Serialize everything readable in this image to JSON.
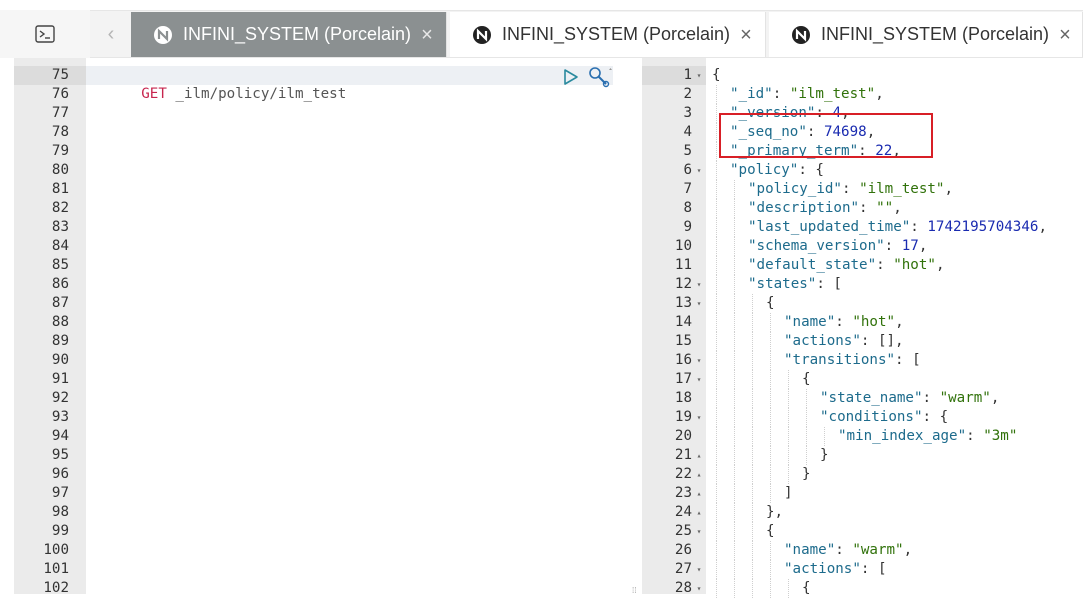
{
  "tabbar": {
    "console_icon": "terminal-icon",
    "prev_icon": "chevron-left-icon",
    "tabs": [
      {
        "label": "INFINI_SYSTEM (Porcelain)",
        "active": true,
        "icon": "cluster-logo-icon",
        "close": "×"
      },
      {
        "label": "INFINI_SYSTEM (Porcelain)",
        "active": false,
        "icon": "cluster-logo-icon",
        "close": "×"
      },
      {
        "label": "INFINI_SYSTEM (Porcelain)",
        "active": false,
        "icon": "cluster-logo-icon",
        "close": "×"
      }
    ]
  },
  "request_editor": {
    "line_numbers": [
      "75",
      "76",
      "77",
      "78",
      "79",
      "80",
      "81",
      "82",
      "83",
      "84",
      "85",
      "86",
      "87",
      "88",
      "89",
      "90",
      "91",
      "92",
      "93",
      "94",
      "95",
      "96",
      "97",
      "98",
      "99",
      "100",
      "101",
      "102"
    ],
    "method": "GET",
    "url": "_ilm/policy/ilm_test",
    "run_icon": "play-icon",
    "settings_icon": "wrench-icon"
  },
  "response_editor": {
    "lines": [
      {
        "n": "1",
        "fold": "▾",
        "indent": 0,
        "parts": [
          [
            "punc",
            "{"
          ]
        ]
      },
      {
        "n": "2",
        "fold": "",
        "indent": 1,
        "parts": [
          [
            "key",
            "\"_id\""
          ],
          [
            "punc",
            ": "
          ],
          [
            "str",
            "\"ilm_test\""
          ],
          [
            "punc",
            ","
          ]
        ]
      },
      {
        "n": "3",
        "fold": "",
        "indent": 1,
        "parts": [
          [
            "key",
            "\"_version\""
          ],
          [
            "punc",
            ": "
          ],
          [
            "num-v",
            "4"
          ],
          [
            "punc",
            ","
          ]
        ]
      },
      {
        "n": "4",
        "fold": "",
        "indent": 1,
        "parts": [
          [
            "key",
            "\"_seq_no\""
          ],
          [
            "punc",
            ": "
          ],
          [
            "num-v",
            "74698"
          ],
          [
            "punc",
            ","
          ]
        ]
      },
      {
        "n": "5",
        "fold": "",
        "indent": 1,
        "parts": [
          [
            "key",
            "\"_primary_term\""
          ],
          [
            "punc",
            ": "
          ],
          [
            "num-v",
            "22"
          ],
          [
            "punc",
            ","
          ]
        ]
      },
      {
        "n": "6",
        "fold": "▾",
        "indent": 1,
        "parts": [
          [
            "key",
            "\"policy\""
          ],
          [
            "punc",
            ": {"
          ]
        ]
      },
      {
        "n": "7",
        "fold": "",
        "indent": 2,
        "parts": [
          [
            "key",
            "\"policy_id\""
          ],
          [
            "punc",
            ": "
          ],
          [
            "str",
            "\"ilm_test\""
          ],
          [
            "punc",
            ","
          ]
        ]
      },
      {
        "n": "8",
        "fold": "",
        "indent": 2,
        "parts": [
          [
            "key",
            "\"description\""
          ],
          [
            "punc",
            ": "
          ],
          [
            "str",
            "\"\""
          ],
          [
            "punc",
            ","
          ]
        ]
      },
      {
        "n": "9",
        "fold": "",
        "indent": 2,
        "parts": [
          [
            "key",
            "\"last_updated_time\""
          ],
          [
            "punc",
            ": "
          ],
          [
            "num-v",
            "1742195704346"
          ],
          [
            "punc",
            ","
          ]
        ]
      },
      {
        "n": "10",
        "fold": "",
        "indent": 2,
        "parts": [
          [
            "key",
            "\"schema_version\""
          ],
          [
            "punc",
            ": "
          ],
          [
            "num-v",
            "17"
          ],
          [
            "punc",
            ","
          ]
        ]
      },
      {
        "n": "11",
        "fold": "",
        "indent": 2,
        "parts": [
          [
            "key",
            "\"default_state\""
          ],
          [
            "punc",
            ": "
          ],
          [
            "str",
            "\"hot\""
          ],
          [
            "punc",
            ","
          ]
        ]
      },
      {
        "n": "12",
        "fold": "▾",
        "indent": 2,
        "parts": [
          [
            "key",
            "\"states\""
          ],
          [
            "punc",
            ": ["
          ]
        ]
      },
      {
        "n": "13",
        "fold": "▾",
        "indent": 3,
        "parts": [
          [
            "punc",
            "{"
          ]
        ]
      },
      {
        "n": "14",
        "fold": "",
        "indent": 4,
        "parts": [
          [
            "key",
            "\"name\""
          ],
          [
            "punc",
            ": "
          ],
          [
            "str",
            "\"hot\""
          ],
          [
            "punc",
            ","
          ]
        ]
      },
      {
        "n": "15",
        "fold": "",
        "indent": 4,
        "parts": [
          [
            "key",
            "\"actions\""
          ],
          [
            "punc",
            ": [],"
          ]
        ]
      },
      {
        "n": "16",
        "fold": "▾",
        "indent": 4,
        "parts": [
          [
            "key",
            "\"transitions\""
          ],
          [
            "punc",
            ": ["
          ]
        ]
      },
      {
        "n": "17",
        "fold": "▾",
        "indent": 5,
        "parts": [
          [
            "punc",
            "{"
          ]
        ]
      },
      {
        "n": "18",
        "fold": "",
        "indent": 6,
        "parts": [
          [
            "key",
            "\"state_name\""
          ],
          [
            "punc",
            ": "
          ],
          [
            "str",
            "\"warm\""
          ],
          [
            "punc",
            ","
          ]
        ]
      },
      {
        "n": "19",
        "fold": "▾",
        "indent": 6,
        "parts": [
          [
            "key",
            "\"conditions\""
          ],
          [
            "punc",
            ": {"
          ]
        ]
      },
      {
        "n": "20",
        "fold": "",
        "indent": 7,
        "parts": [
          [
            "key",
            "\"min_index_age\""
          ],
          [
            "punc",
            ": "
          ],
          [
            "str",
            "\"3m\""
          ]
        ]
      },
      {
        "n": "21",
        "fold": "▴",
        "indent": 6,
        "parts": [
          [
            "punc",
            "}"
          ]
        ]
      },
      {
        "n": "22",
        "fold": "▴",
        "indent": 5,
        "parts": [
          [
            "punc",
            "}"
          ]
        ]
      },
      {
        "n": "23",
        "fold": "▴",
        "indent": 4,
        "parts": [
          [
            "punc",
            "]"
          ]
        ]
      },
      {
        "n": "24",
        "fold": "▴",
        "indent": 3,
        "parts": [
          [
            "punc",
            "},"
          ]
        ]
      },
      {
        "n": "25",
        "fold": "▾",
        "indent": 3,
        "parts": [
          [
            "punc",
            "{"
          ]
        ]
      },
      {
        "n": "26",
        "fold": "",
        "indent": 4,
        "parts": [
          [
            "key",
            "\"name\""
          ],
          [
            "punc",
            ": "
          ],
          [
            "str",
            "\"warm\""
          ],
          [
            "punc",
            ","
          ]
        ]
      },
      {
        "n": "27",
        "fold": "▾",
        "indent": 4,
        "parts": [
          [
            "key",
            "\"actions\""
          ],
          [
            "punc",
            ": ["
          ]
        ]
      },
      {
        "n": "28",
        "fold": "▾",
        "indent": 5,
        "parts": [
          [
            "punc",
            "{"
          ]
        ]
      }
    ]
  },
  "annotation_color": "#d81f26"
}
